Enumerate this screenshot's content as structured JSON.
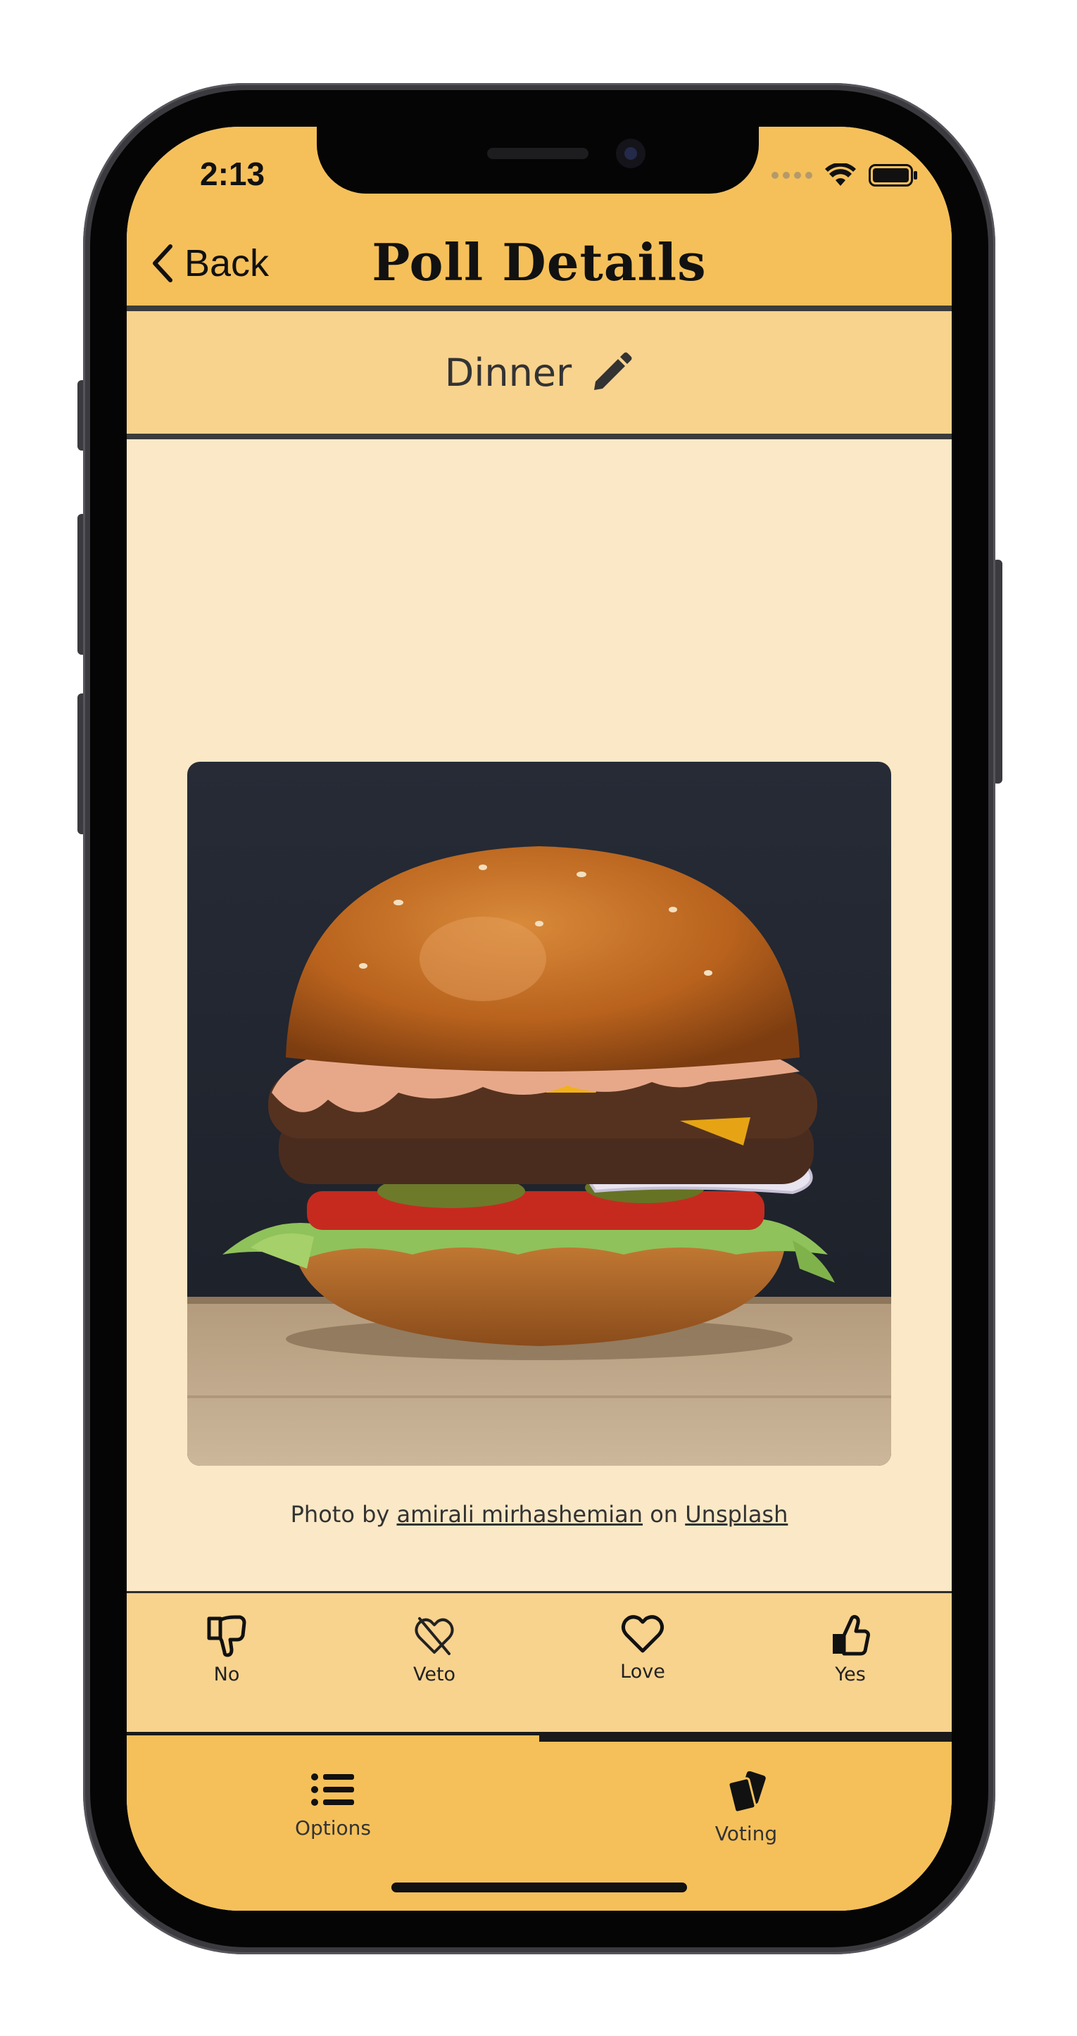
{
  "status_bar": {
    "time": "2:13",
    "signal_icon": "cellular-signal-icon",
    "wifi_icon": "wifi-icon",
    "battery_icon": "battery-icon"
  },
  "header": {
    "back_label": "Back",
    "back_icon": "chevron-left-icon",
    "title": "Poll Details"
  },
  "poll": {
    "name": "Dinner",
    "edit_icon": "pencil-icon"
  },
  "photo": {
    "subject": "burger-photo",
    "credit_prefix": "Photo by",
    "author": "amirali mirhashemian",
    "credit_middle": "on",
    "source": "Unsplash"
  },
  "votes": [
    {
      "label": "No",
      "icon": "thumbs-down-icon"
    },
    {
      "label": "Veto",
      "icon": "broken-heart-icon"
    },
    {
      "label": "Love",
      "icon": "heart-icon"
    },
    {
      "label": "Yes",
      "icon": "thumbs-up-icon"
    }
  ],
  "tabs": [
    {
      "label": "Options",
      "icon": "list-icon",
      "selected": false
    },
    {
      "label": "Voting",
      "icon": "cards-icon",
      "selected": true
    }
  ],
  "colors": {
    "header": "#f5c05a",
    "bar": "#f8d38e",
    "content": "#fbe8c6",
    "dark": "#1a1a1a"
  }
}
